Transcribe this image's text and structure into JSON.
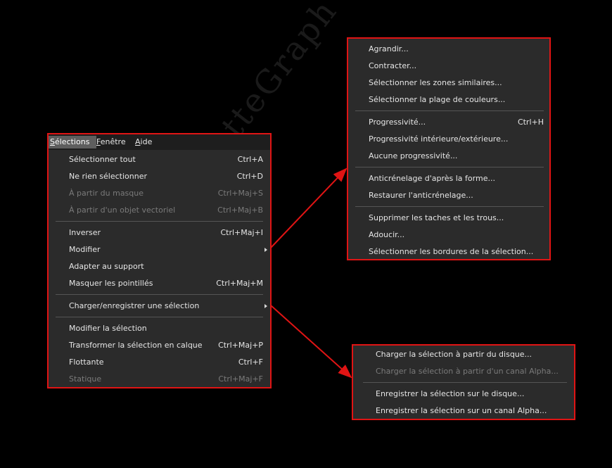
{
  "watermark": "VioletteGraph",
  "colors": {
    "highlight_border": "#e01414",
    "menu_bg": "#2b2b2b",
    "disabled_text": "#7a7a7a"
  },
  "menubar": {
    "items": [
      {
        "label": "Sélections",
        "active": true
      },
      {
        "label": "Fenêtre",
        "active": false
      },
      {
        "label": "Aide",
        "active": false
      }
    ]
  },
  "selections_menu": {
    "groups": [
      [
        {
          "label": "Sélectionner tout",
          "shortcut": "Ctrl+A",
          "disabled": false
        },
        {
          "label": "Ne rien sélectionner",
          "shortcut": "Ctrl+D",
          "disabled": false
        },
        {
          "label": "À partir du masque",
          "shortcut": "Ctrl+Maj+S",
          "disabled": true
        },
        {
          "label": "À partir d'un objet vectoriel",
          "shortcut": "Ctrl+Maj+B",
          "disabled": true
        }
      ],
      [
        {
          "label": "Inverser",
          "shortcut": "Ctrl+Maj+I",
          "disabled": false
        },
        {
          "label": "Modifier",
          "shortcut": "",
          "disabled": false,
          "submenu": true
        },
        {
          "label": "Adapter au support",
          "shortcut": "",
          "disabled": false
        },
        {
          "label": "Masquer les pointillés",
          "shortcut": "Ctrl+Maj+M",
          "disabled": false
        }
      ],
      [
        {
          "label": "Charger/enregistrer une sélection",
          "shortcut": "",
          "disabled": false,
          "submenu": true
        }
      ],
      [
        {
          "label": "Modifier la sélection",
          "shortcut": "",
          "disabled": false
        },
        {
          "label": "Transformer la sélection en calque",
          "shortcut": "Ctrl+Maj+P",
          "disabled": false
        },
        {
          "label": "Flottante",
          "shortcut": "Ctrl+F",
          "disabled": false
        },
        {
          "label": "Statique",
          "shortcut": "Ctrl+Maj+F",
          "disabled": true
        }
      ]
    ]
  },
  "modify_submenu": {
    "groups": [
      [
        {
          "label": "Agrandir...",
          "shortcut": ""
        },
        {
          "label": "Contracter...",
          "shortcut": ""
        },
        {
          "label": "Sélectionner les zones similaires...",
          "shortcut": ""
        },
        {
          "label": "Sélectionner la plage de couleurs...",
          "shortcut": ""
        }
      ],
      [
        {
          "label": "Progressivité...",
          "shortcut": "Ctrl+H"
        },
        {
          "label": "Progressivité intérieure/extérieure...",
          "shortcut": ""
        },
        {
          "label": "Aucune progressivité...",
          "shortcut": ""
        }
      ],
      [
        {
          "label": "Anticrénelage d'après la forme...",
          "shortcut": ""
        },
        {
          "label": "Restaurer l'anticrénelage...",
          "shortcut": ""
        }
      ],
      [
        {
          "label": "Supprimer les taches et les trous...",
          "shortcut": ""
        },
        {
          "label": "Adoucir...",
          "shortcut": ""
        },
        {
          "label": "Sélectionner les bordures de la sélection...",
          "shortcut": ""
        }
      ]
    ]
  },
  "load_save_submenu": {
    "groups": [
      [
        {
          "label": "Charger la sélection à partir du disque...",
          "disabled": false
        },
        {
          "label": "Charger la sélection à partir d'un canal Alpha...",
          "disabled": true
        }
      ],
      [
        {
          "label": "Enregistrer la sélection sur le disque...",
          "disabled": false
        },
        {
          "label": "Enregistrer la sélection sur un canal Alpha...",
          "disabled": false
        }
      ]
    ]
  }
}
